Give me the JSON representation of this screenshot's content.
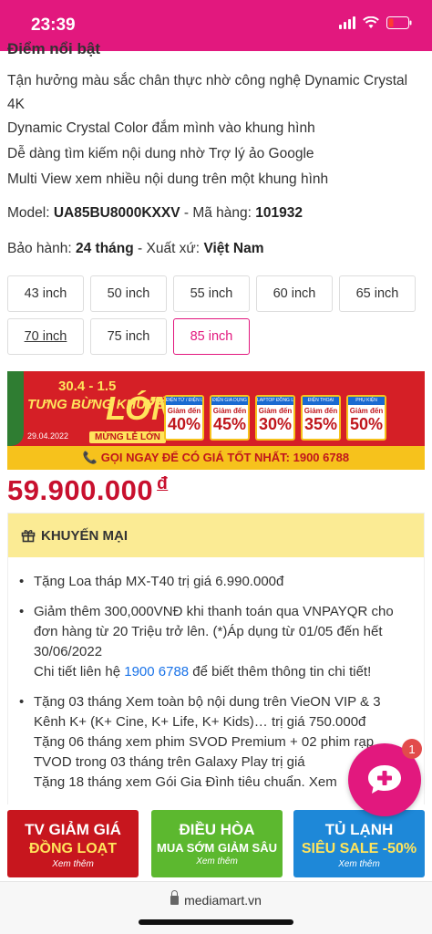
{
  "status_bar": {
    "time": "23:39"
  },
  "features": {
    "heading_cut": "Điểm nổi bật",
    "lines": [
      "Tận hưởng màu sắc chân thực nhờ công nghệ Dynamic Crystal 4K",
      "Dynamic Crystal Color đắm mình vào khung hình",
      "Dễ dàng tìm kiếm nội dung nhờ Trợ lý ảo Google",
      "Multi View xem nhiều nội dung trên một khung hình"
    ]
  },
  "product": {
    "model_label": "Model: ",
    "model": "UA85BU8000KXXV",
    "sku_label": " - Mã hàng: ",
    "sku": "101932",
    "warranty_label": "Bảo hành: ",
    "warranty": "24 tháng",
    "origin_label": " - Xuất xứ: ",
    "origin": "Việt Nam",
    "price": "59.900.000",
    "currency": "đ"
  },
  "sizes": [
    "43 inch",
    "50 inch",
    "55 inch",
    "60 inch",
    "65 inch",
    "70 inch",
    "75 inch",
    "85 inch"
  ],
  "selected_size": "85 inch",
  "promo_banner": {
    "title1": "30.4 - 1.5",
    "title2": "TƯNG BỪNG KHUYẾN MẠI",
    "title3": "LỚN",
    "date": "29.04.2022",
    "sub": "MỪNG LỄ LỚN",
    "deals": [
      {
        "cat": "ĐIỆN TỬ / ĐIỆN LẠNH",
        "label": "Giảm đến",
        "pct": "40%"
      },
      {
        "cat": "ĐIỆN GIA DỤNG",
        "label": "Giảm đến",
        "pct": "45%"
      },
      {
        "cat": "LAPTOP ĐỒNG LOẠT",
        "label": "Giảm đến",
        "pct": "30%"
      },
      {
        "cat": "ĐIỆN THOẠI",
        "label": "Giảm đến",
        "pct": "35%"
      },
      {
        "cat": "PHỤ KIỆN",
        "label": "Giảm đến",
        "pct": "50%"
      }
    ],
    "footer": "📞 GỌI NGAY ĐỂ CÓ GIÁ TỐT NHẤT: 1900 6788"
  },
  "khuyen_mai": {
    "title": "KHUYẾN MẠI",
    "item1": "Tặng Loa tháp MX-T40 trị giá 6.990.000đ",
    "item2_main": "Giảm thêm 300,000VNĐ khi thanh toán qua VNPAYQR cho đơn hàng từ 20 Triệu trở lên. (*)Áp dụng từ 01/05 đến hết 30/06/2022",
    "item2_contact_pre": "Chi tiết liên hệ ",
    "item2_phone": "1900 6788",
    "item2_contact_post": " để biết thêm thông tin chi tiết!",
    "item3_a": "Tặng 03 tháng Xem toàn bộ nội dung trên VieON VIP & 3 Kênh K+ (K+ Cine, K+ Life, K+ Kids)… trị giá 750.000đ",
    "item3_b": "Tặng 06 tháng xem phim SVOD Premium + 02 phim rạp TVOD trong 03 tháng trên Galaxy Play trị giá",
    "item3_c": "Tặng 18 tháng xem Gói Gia Đình tiêu chuẩn. Xem"
  },
  "bottom_banners": [
    {
      "l1": "TV GIẢM GIÁ",
      "l2": "ĐỒNG LOẠT",
      "l3": "Xem thêm",
      "color": "#c7161e"
    },
    {
      "l1": "ĐIỀU HÒA",
      "l2": "MUA SỚM GIẢM SÂU",
      "l3": "Xem thêm",
      "color": "#5cb82f"
    },
    {
      "l1": "TỦ LẠNH",
      "l2": "SIÊU SALE -50%",
      "l3": "Xem thêm",
      "color": "#1e88d8"
    }
  ],
  "chat": {
    "badge": "1"
  },
  "browser": {
    "url": "mediamart.vn"
  },
  "colors": {
    "brand": "#e2187e",
    "price": "#c8102e",
    "link": "#1a73e8"
  }
}
